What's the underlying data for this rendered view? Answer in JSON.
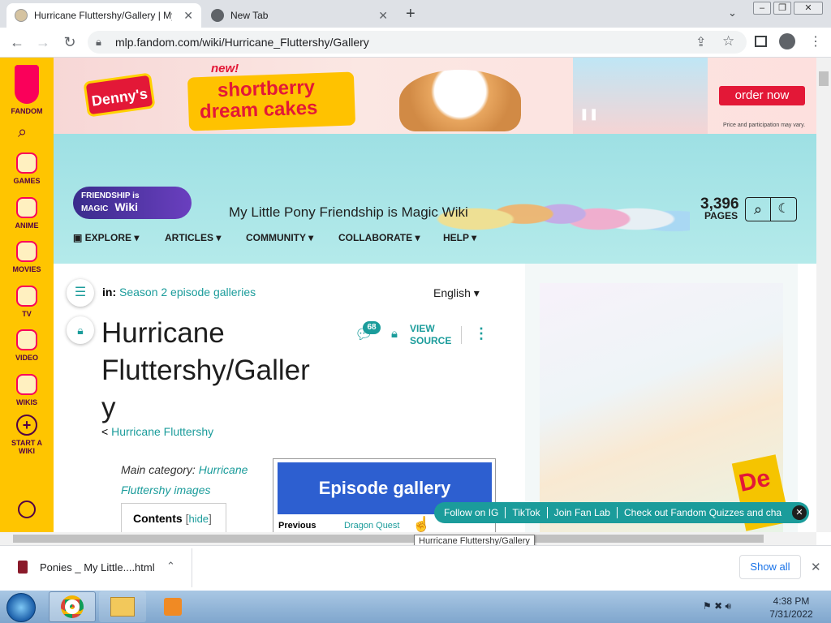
{
  "browser": {
    "tabs": [
      {
        "label": "Hurricane Fluttershy/Gallery | My"
      },
      {
        "label": "New Tab"
      }
    ],
    "new_tab_symbol": "+",
    "url": "mlp.fandom.com/wiki/Hurricane_Fluttershy/Gallery",
    "window_controls": [
      "–",
      "❐",
      "✕"
    ]
  },
  "rail": {
    "brand": "FANDOM",
    "items": [
      {
        "label": "GAMES"
      },
      {
        "label": "ANIME"
      },
      {
        "label": "MOVIES"
      },
      {
        "label": "TV"
      },
      {
        "label": "VIDEO"
      },
      {
        "label": "WIKIS"
      },
      {
        "label": "START A WIKI"
      }
    ]
  },
  "ad": {
    "brand": "Denny's",
    "badge": "new!",
    "headline_1": "shortberry",
    "headline_2": "dream cakes",
    "cta": "order now",
    "disclaimer": "Price and participation may vary."
  },
  "wiki": {
    "logo_1": "FRIENDSHIP is MAGIC",
    "logo_2": "Wiki",
    "title": "My Little Pony Friendship is Magic Wiki",
    "pages_count": "3,396",
    "pages_label": "PAGES",
    "nav": [
      "EXPLORE",
      "ARTICLES",
      "COMMUNITY",
      "COLLABORATE",
      "HELP"
    ]
  },
  "article": {
    "in_label": "in:",
    "category": "Season 2 episode galleries",
    "language": "English",
    "title_line1": "Hurricane",
    "title_line2": "Fluttershy/Galler",
    "title_line3": "y",
    "comments": "68",
    "view_source_1": "VIEW",
    "view_source_2": "SOURCE",
    "back_prefix": "<",
    "back_link": "Hurricane Fluttershy",
    "main_cat_label": "Main category:",
    "main_cat_link": "Hurricane Fluttershy images",
    "contents": "Contents",
    "hide": "hide",
    "gallery_heading": "Episode gallery",
    "previous": "Previous",
    "prev_link": "Dragon Quest"
  },
  "social_bar": [
    "Follow on IG",
    "TikTok",
    "Join Fan Lab",
    "Check out Fandom Quizzes and cha"
  ],
  "tooltip": "Hurricane Fluttershy/Gallery",
  "download": {
    "filename": "Ponies _ My Little....html",
    "show_all": "Show all"
  },
  "taskbar": {
    "time": "4:38 PM",
    "date": "7/31/2022"
  },
  "colors": {
    "fandom_yellow": "#ffc500",
    "fandom_pink": "#fa005a",
    "teal": "#1b9c9b",
    "gallery_blue": "#2d5fd0"
  }
}
